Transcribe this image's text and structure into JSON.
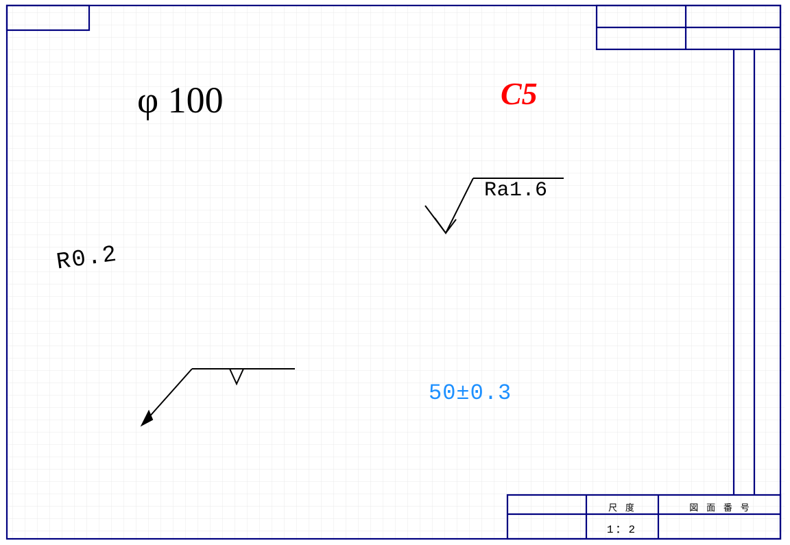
{
  "annotations": {
    "diameter": "φ 100",
    "chamfer": "C5",
    "surface_roughness": "Ra1.6",
    "radius": "R0.2",
    "tolerance": "50±0.3"
  },
  "title_block": {
    "scale_label": "尺 度",
    "scale_value": "1：2",
    "drawing_number_label": "図 面 番 号",
    "drawing_number_value": ""
  },
  "colors": {
    "frame": "#000080",
    "grid": "#e8e8ea",
    "accent_red": "#ff0000",
    "accent_blue": "#1e90ff"
  }
}
